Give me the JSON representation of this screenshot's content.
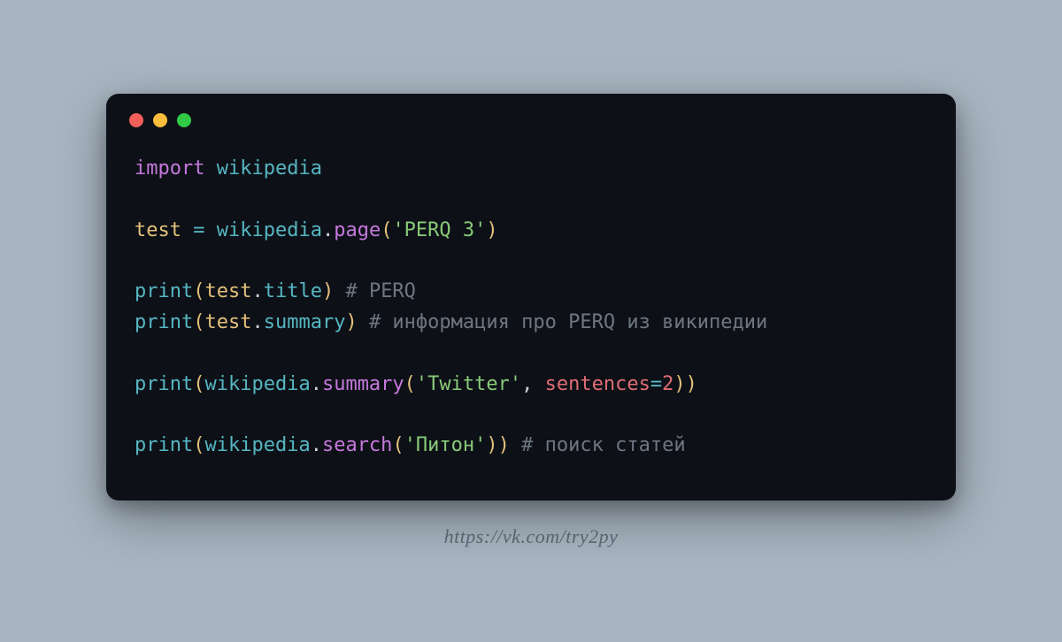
{
  "code": {
    "line1": {
      "kw": "import",
      "mod": "wikipedia"
    },
    "line3": {
      "var": "test",
      "op": "=",
      "mod": "wikipedia",
      "fn": "page",
      "arg": "'PERQ 3'"
    },
    "line5": {
      "bi": "print",
      "var": "test",
      "attr": "title",
      "comment": "# PERQ"
    },
    "line6": {
      "bi": "print",
      "var": "test",
      "attr": "summary",
      "comment": "# информация про PERQ из википедии"
    },
    "line8": {
      "bi": "print",
      "mod": "wikipedia",
      "fn": "summary",
      "arg1": "'Twitter'",
      "kwarg": "sentences",
      "eq": "=",
      "num": "2"
    },
    "line10": {
      "bi": "print",
      "mod": "wikipedia",
      "fn": "search",
      "arg": "'Питон'",
      "comment": "# поиск статей"
    }
  },
  "footer": "https://vk.com/try2py"
}
